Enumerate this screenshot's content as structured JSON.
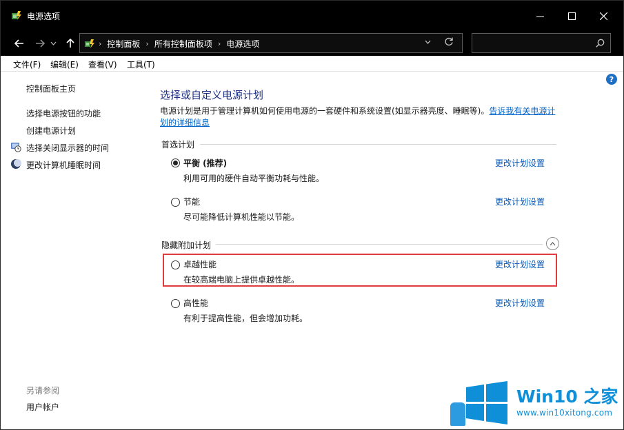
{
  "window": {
    "title": "电源选项",
    "minimize_glyph": "—",
    "maximize_glyph": "☐",
    "close_glyph": "✕"
  },
  "nav": {
    "back_glyph": "←",
    "forward_glyph": "→",
    "recent_glyph": "⌄",
    "up_glyph": "↑",
    "breadcrumbs": [
      "控制面板",
      "所有控制面板项",
      "电源选项"
    ],
    "dropdown_glyph": "⌄",
    "refresh_glyph": "↻",
    "search_placeholder": ""
  },
  "menu": {
    "items": [
      "文件(F)",
      "编辑(E)",
      "查看(V)",
      "工具(T)"
    ]
  },
  "help": {
    "glyph": "?"
  },
  "sidebar": {
    "home": "控制面板主页",
    "items": [
      {
        "label": "选择电源按钮的功能",
        "icon": "none"
      },
      {
        "label": "创建电源计划",
        "icon": "none"
      },
      {
        "label": "选择关闭显示器的时间",
        "icon": "monitor-clock-icon"
      },
      {
        "label": "更改计算机睡眠时间",
        "icon": "moon-icon"
      }
    ],
    "see_also": "另请参阅",
    "see_also_items": [
      "用户帐户"
    ]
  },
  "main": {
    "title": "选择或自定义电源计划",
    "desc_text": "电源计划是用于管理计算机如何使用电源的一套硬件和系统设置(如显示器亮度、睡眠等)。",
    "desc_link_1": "告诉我有关电源计",
    "desc_link_2": "划的详细信息",
    "preferred_label": "首选计划",
    "hidden_label": "隐藏附加计划",
    "plans": [
      {
        "name": "平衡 (推荐)",
        "desc": "利用可用的硬件自动平衡功耗与性能。",
        "link": "更改计划设置",
        "checked": true
      },
      {
        "name": "节能",
        "desc": "尽可能降低计算机性能以节能。",
        "link": "更改计划设置",
        "checked": false
      },
      {
        "name": "卓越性能",
        "desc": "在较高端电脑上提供卓越性能。",
        "link": "更改计划设置",
        "checked": false
      },
      {
        "name": "高性能",
        "desc": "有利于提高性能，但会增加功耗。",
        "link": "更改计划设置",
        "checked": false
      }
    ]
  },
  "watermark": {
    "brand": "Win10 之家",
    "url": "www.win10xitong.com"
  },
  "colors": {
    "titlebar": "#000000",
    "link": "#0a5bb5",
    "heading": "#1e3287",
    "highlight": "#e03c3c",
    "brand": "#0e8fd8"
  }
}
